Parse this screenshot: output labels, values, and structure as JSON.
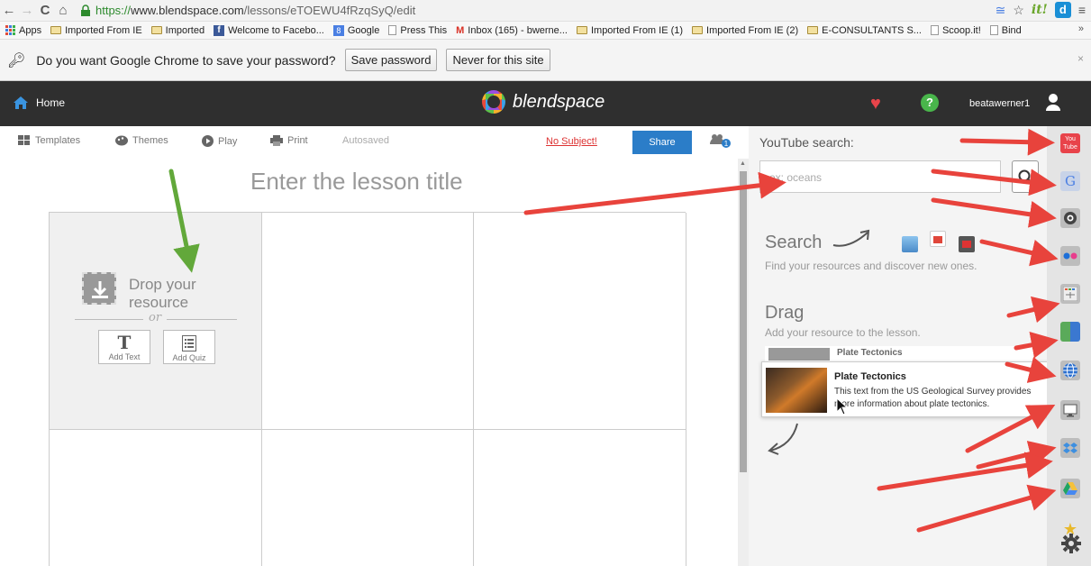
{
  "browser": {
    "url_scheme": "https://",
    "url_domain": "www.blendspace.com",
    "url_path": "/lessons/eTOEWU4fRzqSyQ/edit",
    "bookmarks": [
      {
        "icon": "apps-icon",
        "label": "Apps"
      },
      {
        "icon": "folder-icon",
        "label": "Imported From IE"
      },
      {
        "icon": "folder-icon",
        "label": "Imported"
      },
      {
        "icon": "facebook-icon",
        "label": "Welcome to Facebo..."
      },
      {
        "icon": "google-icon",
        "label": "Google"
      },
      {
        "icon": "page-icon",
        "label": "Press This"
      },
      {
        "icon": "gmail-icon",
        "label": "Inbox (165) - bwerne..."
      },
      {
        "icon": "folder-icon",
        "label": "Imported From IE (1)"
      },
      {
        "icon": "folder-icon",
        "label": "Imported From IE (2)"
      },
      {
        "icon": "folder-icon",
        "label": "E-CONSULTANTS S..."
      },
      {
        "icon": "page-icon",
        "label": "Scoop.it!"
      },
      {
        "icon": "page-icon",
        "label": "Bind"
      }
    ],
    "more_label": "»",
    "ext_d_label": "d",
    "ext_it_label": "it!"
  },
  "password_bar": {
    "prompt": "Do you want Google Chrome to save your password?",
    "save_label": "Save password",
    "never_label": "Never for this site",
    "close_label": "×"
  },
  "header": {
    "home_label": "Home",
    "brand": "blendspace",
    "help_label": "?",
    "username": "beatawerner1"
  },
  "toolbar": {
    "templates_label": "Templates",
    "themes_label": "Themes",
    "play_label": "Play",
    "print_label": "Print",
    "status": "Autosaved",
    "no_subject_label": "No Subject!",
    "share_label": "Share",
    "collab_count": "1"
  },
  "lesson": {
    "title_placeholder": "Enter the lesson title",
    "drop_line1": "Drop your",
    "drop_line2": "resource",
    "or_label": "or",
    "add_text_glyph": "T",
    "add_text_label": "Add Text",
    "add_quiz_label": "Add Quiz"
  },
  "panel": {
    "search_label": "YouTube search:",
    "search_placeholder": "ex: oceans",
    "search_title": "Search",
    "search_sub": "Find your resources and discover new ones.",
    "drag_title": "Drag",
    "drag_sub": "Add your resource to the lesson.",
    "result_title": "Plate Tectonics",
    "card_title": "Plate Tectonics",
    "card_desc": "This text from the US Geological Survey provides more information about plate tectonics."
  },
  "rail": {
    "youtube_label": "You Tube",
    "google_label": "G",
    "items": [
      "youtube-icon",
      "google-icon",
      "educreations-icon",
      "flickr-icon",
      "calculator-icon",
      "gooru-icon",
      "globe-icon",
      "computer-icon",
      "dropbox-icon",
      "google-drive-icon",
      "star-icon",
      "settings-icon"
    ]
  },
  "colors": {
    "header_bg": "#2f2f2f",
    "share_blue": "#2b7dc8",
    "no_subject_red": "#dd3333",
    "arrow_red": "#e8433c",
    "arrow_green": "#62a83a"
  }
}
